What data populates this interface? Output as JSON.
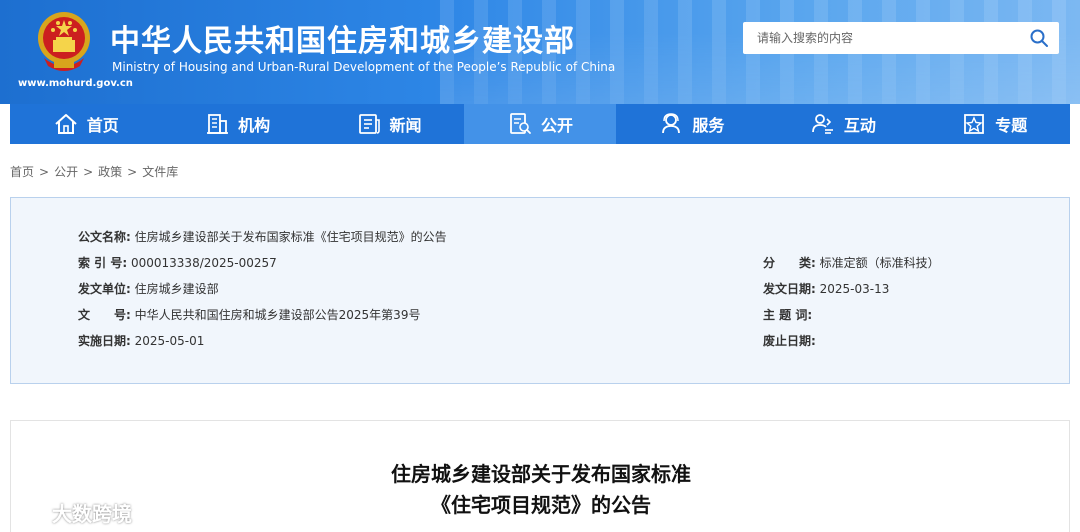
{
  "header": {
    "title_cn": "中华人民共和国住房和城乡建设部",
    "title_en": "Ministry of Housing and Urban-Rural Development of the People’s Republic of China",
    "site_url": "www.mohurd.gov.cn",
    "search_placeholder": "请输入搜索的内容"
  },
  "nav": {
    "items": [
      {
        "label": "首页",
        "icon": "home-icon"
      },
      {
        "label": "机构",
        "icon": "building-icon"
      },
      {
        "label": "新闻",
        "icon": "news-icon"
      },
      {
        "label": "公开",
        "icon": "disclosure-icon"
      },
      {
        "label": "服务",
        "icon": "service-icon"
      },
      {
        "label": "互动",
        "icon": "interaction-icon"
      },
      {
        "label": "专题",
        "icon": "topic-icon"
      }
    ],
    "active_index": 3
  },
  "breadcrumb": [
    "首页",
    "公开",
    "政策",
    "文件库"
  ],
  "breadcrumb_sep": ">",
  "meta": {
    "name_label": "公文名称:",
    "name_value": "住房城乡建设部关于发布国家标准《住宅项目规范》的公告",
    "index_label": "索 引 号:",
    "index_value": "000013338/2025-00257",
    "category_label": "分　　类:",
    "category_value": "标准定额（标准科技）",
    "issuer_label": "发文单位:",
    "issuer_value": "住房城乡建设部",
    "date_label": "发文日期:",
    "date_value": "2025-03-13",
    "docno_label": "文　　号:",
    "docno_value": "中华人民共和国住房和城乡建设部公告2025年第39号",
    "subject_label": "主 题 词:",
    "subject_value": "",
    "effective_label": "实施日期:",
    "effective_value": "2025-05-01",
    "repeal_label": "废止日期:",
    "repeal_value": ""
  },
  "content": {
    "title_line1": "住房城乡建设部关于发布国家标准",
    "title_line2": "《住宅项目规范》的公告"
  },
  "watermark": "大数跨境",
  "colors": {
    "nav_bg": "#1f73d8",
    "nav_active": "#4392e8",
    "meta_bg": "#f1f6fc",
    "meta_border": "#b9d1ed"
  }
}
